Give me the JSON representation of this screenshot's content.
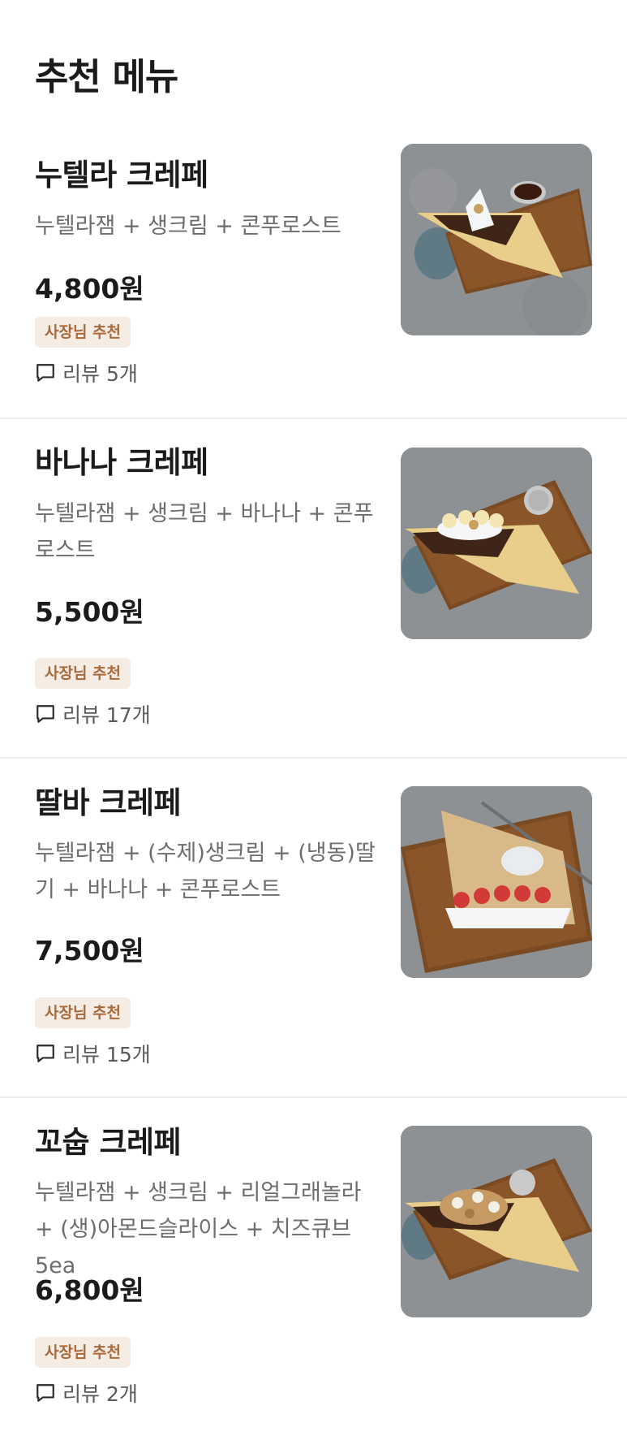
{
  "section": {
    "title": "추천 메뉴"
  },
  "menu_items": [
    {
      "name": "누텔라 크레페",
      "description": "누텔라잼 + 생크림 + 콘푸로스트",
      "price": "4,800원",
      "badge": "사장님 추천",
      "review": "리뷰 5개",
      "image_icon": "nutella-crepe-photo"
    },
    {
      "name": "바나나 크레페",
      "description": "누텔라잼 + 생크림 + 바나나 + 콘푸로스트",
      "price": "5,500원",
      "badge": "사장님 추천",
      "review": "리뷰 17개",
      "image_icon": "banana-crepe-photo"
    },
    {
      "name": "딸바 크레페",
      "description": "누텔라잼 + (수제)생크림 + (냉동)딸기 + 바나나 + 콘푸로스트",
      "price": "7,500원",
      "badge": "사장님 추천",
      "review": "리뷰 15개",
      "image_icon": "strawberry-banana-crepe-photo"
    },
    {
      "name": "꼬숩 크레페",
      "description": "누텔라잼 + 생크림 + 리얼그래놀라 + (생)아몬드슬라이스 + 치즈큐브 5ea",
      "price": "6,800원",
      "badge": "사장님 추천",
      "review": "리뷰 2개",
      "image_icon": "granola-crepe-photo"
    }
  ],
  "colors": {
    "badge_background": "#f5ede4",
    "badge_text": "#a86a3c",
    "description_text": "#6d6d6d",
    "title_text": "#1b1b1b"
  }
}
